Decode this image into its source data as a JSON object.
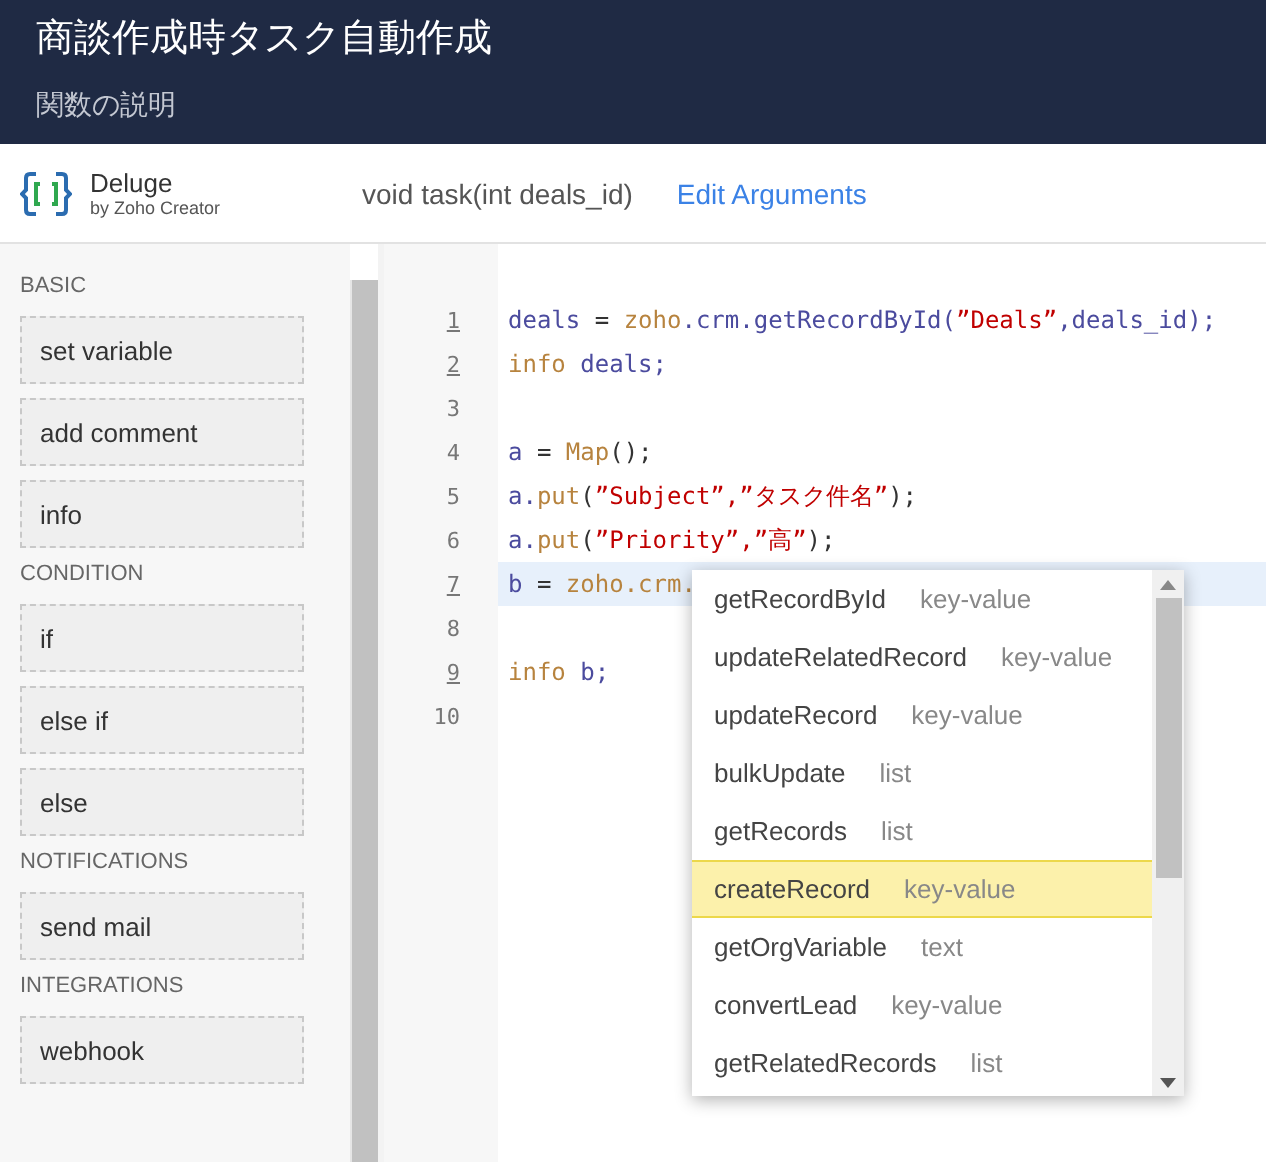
{
  "header": {
    "title": "商談作成時タスク自動作成",
    "description": "関数の説明"
  },
  "toolbar": {
    "brand": "Deluge",
    "brand_sub": "by Zoho Creator",
    "signature": "void  task(int deals_id)",
    "edit_link": "Edit Arguments"
  },
  "sidebar": {
    "sections": [
      {
        "heading": "BASIC",
        "items": [
          "set variable",
          "add comment",
          "info"
        ]
      },
      {
        "heading": "CONDITION",
        "items": [
          "if",
          "else if",
          "else"
        ]
      },
      {
        "heading": "NOTIFICATIONS",
        "items": [
          "send mail"
        ]
      },
      {
        "heading": "INTEGRATIONS",
        "items": [
          "webhook"
        ]
      }
    ]
  },
  "editor": {
    "lines": [
      {
        "number": "1",
        "underlined": true,
        "current": false,
        "tokens": [
          {
            "t": "deals",
            "kind": "var"
          },
          {
            "t": " = ",
            "kind": "plain"
          },
          {
            "t": "zoho",
            "kind": "fn"
          },
          {
            "t": ".crm.getRecordById(",
            "kind": "var"
          },
          {
            "t": "”Deals”",
            "kind": "str"
          },
          {
            "t": ",deals_id);",
            "kind": "var"
          }
        ]
      },
      {
        "number": "2",
        "underlined": true,
        "current": false,
        "tokens": [
          {
            "t": "info",
            "kind": "fn"
          },
          {
            "t": " deals;",
            "kind": "var"
          }
        ]
      },
      {
        "number": "3",
        "underlined": false,
        "current": false
      },
      {
        "number": "4",
        "underlined": false,
        "current": false,
        "tokens": [
          {
            "t": "a",
            "kind": "var"
          },
          {
            "t": " = ",
            "kind": "plain"
          },
          {
            "t": "Map",
            "kind": "fn"
          },
          {
            "t": "();",
            "kind": "plain"
          }
        ]
      },
      {
        "number": "5",
        "underlined": false,
        "current": false,
        "tokens": [
          {
            "t": "a.",
            "kind": "var"
          },
          {
            "t": "put",
            "kind": "fn"
          },
          {
            "t": "(",
            "kind": "plain"
          },
          {
            "t": "”Subject”,”タスク件名”",
            "kind": "str"
          },
          {
            "t": ");",
            "kind": "plain"
          }
        ]
      },
      {
        "number": "6",
        "underlined": false,
        "current": false,
        "tokens": [
          {
            "t": "a.",
            "kind": "var"
          },
          {
            "t": "put",
            "kind": "fn"
          },
          {
            "t": "(",
            "kind": "plain"
          },
          {
            "t": "”Priority”,”高”",
            "kind": "str"
          },
          {
            "t": ");",
            "kind": "plain"
          }
        ]
      },
      {
        "number": "7",
        "underlined": true,
        "current": true,
        "tokens": [
          {
            "t": "b",
            "kind": "var"
          },
          {
            "t": " = ",
            "kind": "plain"
          },
          {
            "t": "zoho.crm.",
            "kind": "fn"
          }
        ]
      },
      {
        "number": "8",
        "underlined": false,
        "current": false
      },
      {
        "number": "9",
        "underlined": true,
        "current": false,
        "tokens": [
          {
            "t": "info",
            "kind": "fn"
          },
          {
            "t": " b;",
            "kind": "var"
          }
        ]
      },
      {
        "number": "10",
        "underlined": false,
        "current": false
      }
    ]
  },
  "autocomplete": {
    "items": [
      {
        "name": "getRecordById",
        "type": "key-value",
        "selected": false
      },
      {
        "name": "updateRelatedRecord",
        "type": "key-value",
        "selected": false
      },
      {
        "name": "updateRecord",
        "type": "key-value",
        "selected": false
      },
      {
        "name": "bulkUpdate",
        "type": "list",
        "selected": false
      },
      {
        "name": "getRecords",
        "type": "list",
        "selected": false
      },
      {
        "name": "createRecord",
        "type": "key-value",
        "selected": true
      },
      {
        "name": "getOrgVariable",
        "type": "text",
        "selected": false
      },
      {
        "name": "convertLead",
        "type": "key-value",
        "selected": false
      },
      {
        "name": "getRelatedRecords",
        "type": "list",
        "selected": false
      }
    ]
  }
}
